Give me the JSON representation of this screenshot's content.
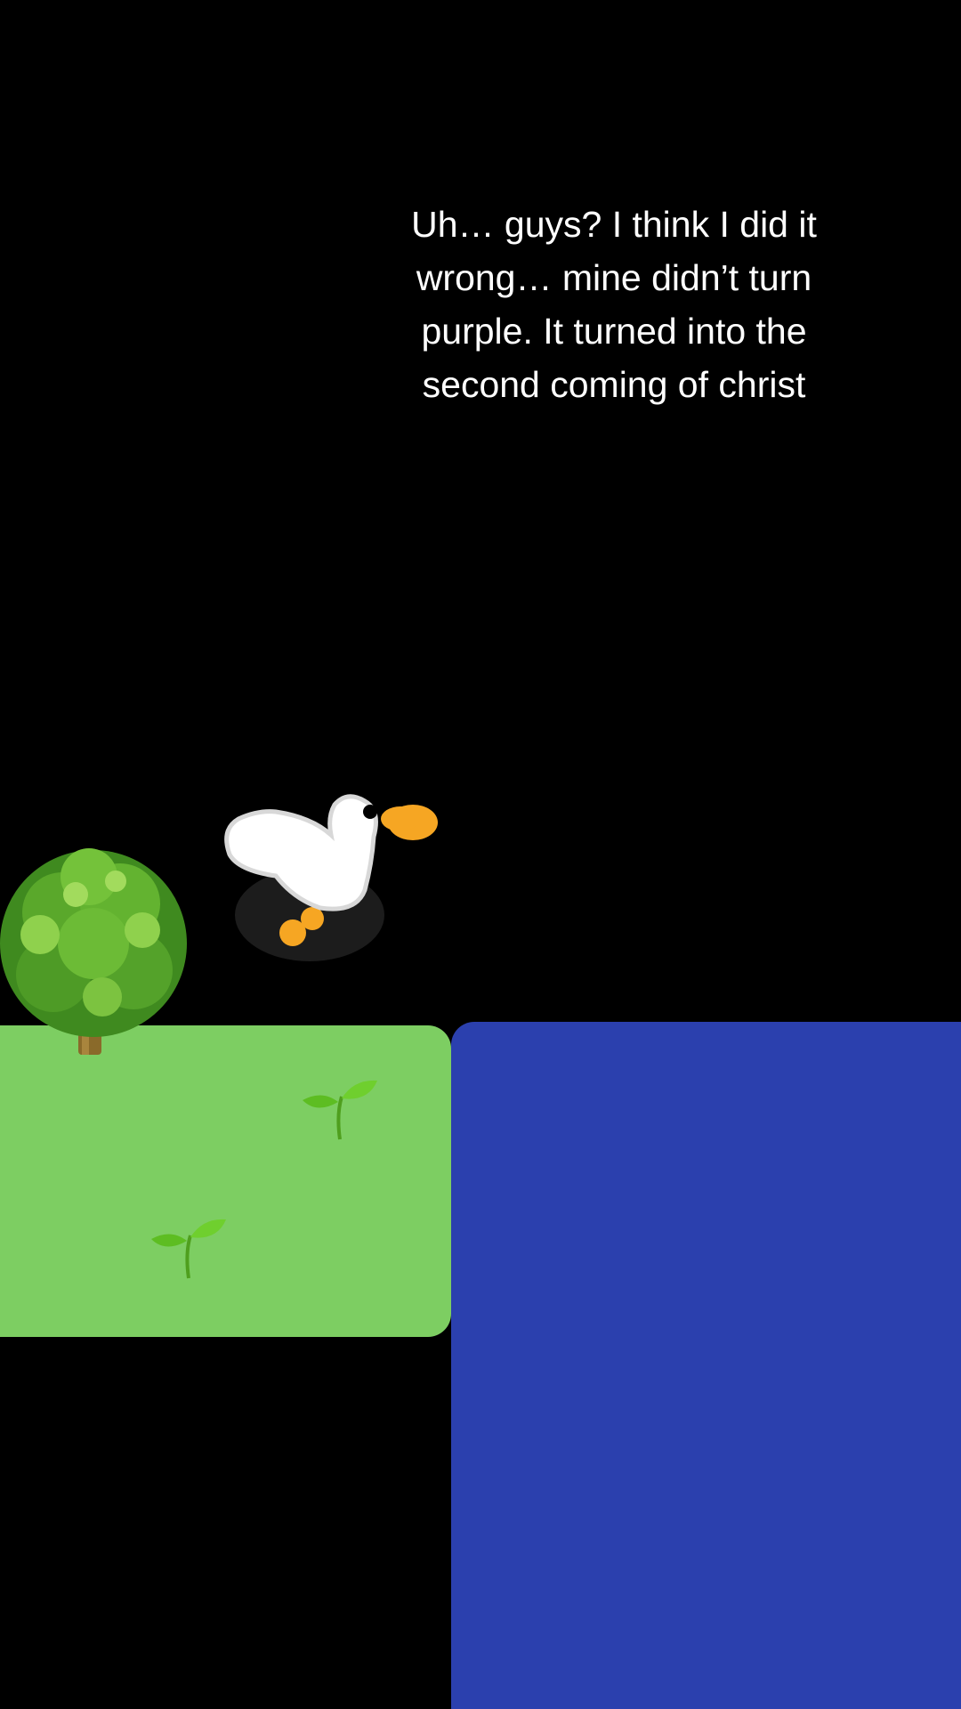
{
  "caption": {
    "lines": [
      "Uh… guys? I think I did it",
      "wrong… mine didn’t turn",
      "purple. It turned into the",
      "second coming of christ"
    ]
  },
  "scene": {
    "icons": [
      "tree-icon",
      "goose-icon",
      "sprout-icon",
      "sprout-icon"
    ],
    "colors": {
      "background": "#000000",
      "grass": "#7dce62",
      "dirt": "#a58c5f",
      "water": "#2b40ae",
      "goose_body": "#ffffff",
      "goose_beak": "#f6a623"
    }
  }
}
